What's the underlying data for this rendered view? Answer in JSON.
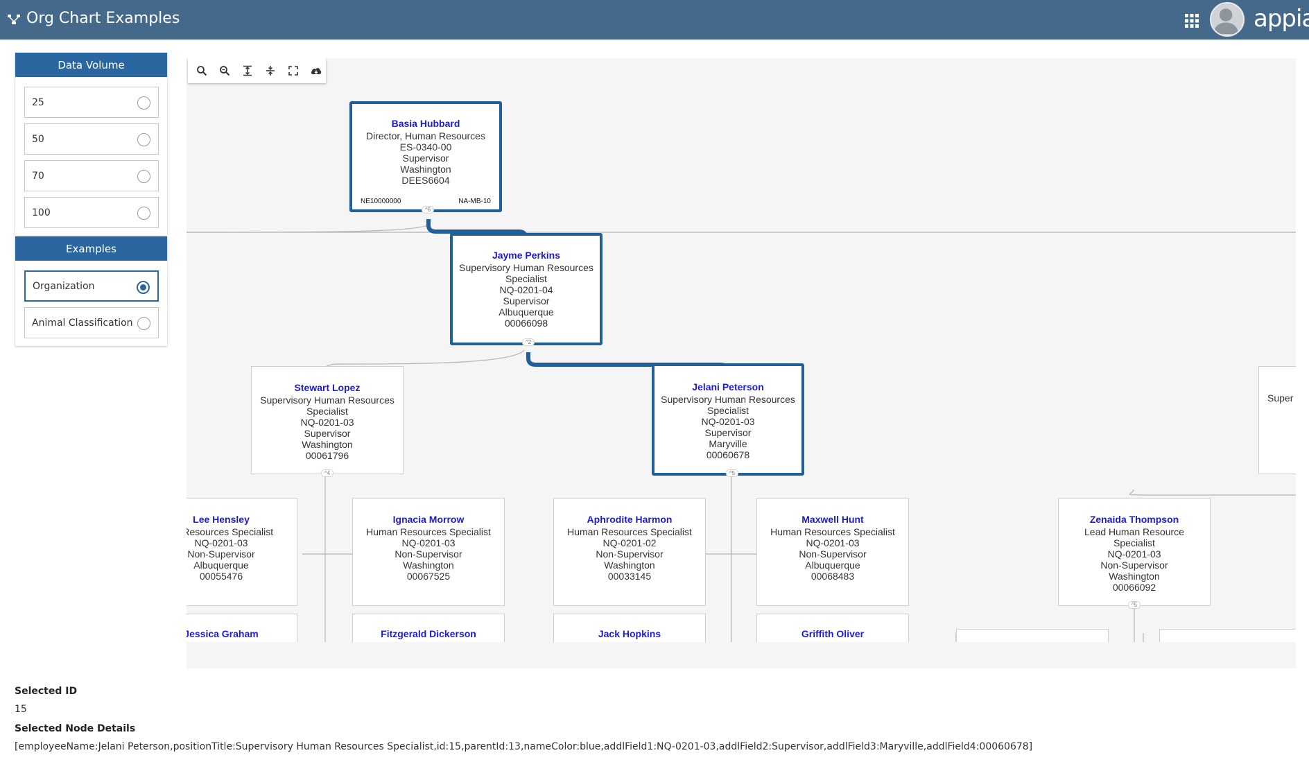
{
  "header": {
    "title": "Org Chart Examples",
    "brand": "appian",
    "icons": {
      "logo": "org-chart-icon",
      "apps": "grid-icon",
      "user": "avatar"
    },
    "bg_color": "#45698b"
  },
  "data_volume": {
    "title": "Data Volume",
    "options": [
      "25",
      "50",
      "70",
      "100"
    ],
    "selected": null
  },
  "examples": {
    "title": "Examples",
    "options": [
      "Organization",
      "Animal Classification"
    ],
    "selected": "Organization"
  },
  "toolbar": {
    "tools": [
      "zoom-in-icon",
      "zoom-out-icon",
      "expand-vertical-icon",
      "collapse-vertical-icon",
      "fit-screen-icon",
      "cloud-download-icon"
    ]
  },
  "chart": {
    "nodes": {
      "basia": {
        "name": "Basia Hubbard",
        "lines": [
          "Director, Human Resources",
          "ES-0340-00",
          "Supervisor",
          "Washington",
          "DEES6604"
        ],
        "foot_left": "NE10000000",
        "foot_right": "NA-MB-10",
        "expander": "^6"
      },
      "jayme": {
        "name": "Jayme Perkins",
        "lines": [
          "Supervisory Human Resources",
          "Specialist",
          "NQ-0201-04",
          "Supervisor",
          "Albuquerque",
          "00066098"
        ],
        "expander": "^2"
      },
      "stewart": {
        "name": "Stewart Lopez",
        "lines": [
          "Supervisory Human Resources",
          "Specialist",
          "NQ-0201-03",
          "Supervisor",
          "Washington",
          "00061796"
        ],
        "expander": "^4"
      },
      "jelani": {
        "name": "Jelani Peterson",
        "lines": [
          "Supervisory Human Resources",
          "Specialist",
          "NQ-0201-03",
          "Supervisor",
          "Maryville",
          "00060678"
        ],
        "expander": "^5"
      },
      "partial_right": {
        "text": "Super"
      },
      "lee": {
        "name": "Lee Hensley",
        "lines": [
          "an Resources Specialist",
          "NQ-0201-03",
          "Non-Supervisor",
          "Albuquerque",
          "00055476"
        ]
      },
      "ignacia": {
        "name": "Ignacia Morrow",
        "lines": [
          "Human Resources Specialist",
          "NQ-0201-03",
          "Non-Supervisor",
          "Washington",
          "00067525"
        ]
      },
      "aphrodite": {
        "name": "Aphrodite Harmon",
        "lines": [
          "Human Resources Specialist",
          "NQ-0201-02",
          "Non-Supervisor",
          "Washington",
          "00033145"
        ]
      },
      "maxwell": {
        "name": "Maxwell Hunt",
        "lines": [
          "Human Resources Specialist",
          "NQ-0201-03",
          "Non-Supervisor",
          "Albuquerque",
          "00068483"
        ]
      },
      "zenaida": {
        "name": "Zenaida Thompson",
        "lines": [
          "Lead Human Resource",
          "Specialist",
          "NQ-0201-03",
          "Non-Supervisor",
          "Washington",
          "00066092"
        ],
        "expander": "^5"
      },
      "jessica": {
        "name": "Jessica Graham"
      },
      "fitzgerald": {
        "name": "Fitzgerald Dickerson"
      },
      "jack": {
        "name": "Jack Hopkins"
      },
      "griffith": {
        "name": "Griffith Oliver"
      }
    }
  },
  "details": {
    "selected_id_label": "Selected ID",
    "selected_id": "15",
    "node_details_label": "Selected Node Details",
    "node_details": "[employeeName:Jelani Peterson,positionTitle:Supervisory Human Resources Specialist,id:15,parentId:13,nameColor:blue,addlField1:NQ-0201-03,addlField2:Supervisor,addlField3:Maryville,addlField4:00060678]"
  }
}
